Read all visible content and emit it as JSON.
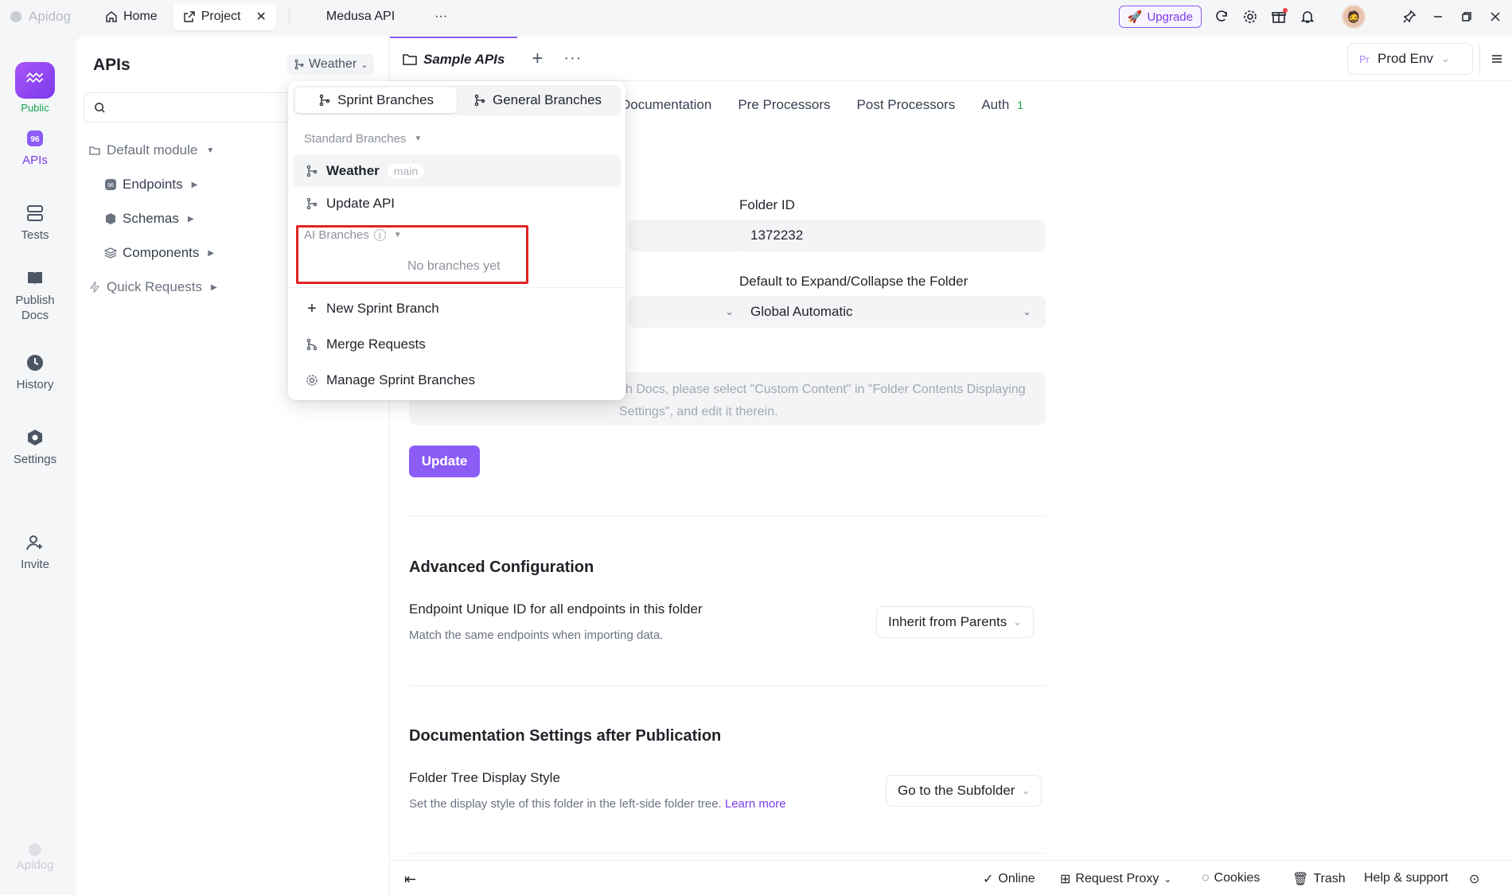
{
  "topbar": {
    "logo": "Apidog",
    "tabs": [
      {
        "label": "Home"
      },
      {
        "label": "Project"
      },
      {
        "label": "Medusa API"
      }
    ],
    "more": "···",
    "upgrade": "Upgrade"
  },
  "rail": {
    "public": "Public",
    "items": [
      {
        "label": "APIs"
      },
      {
        "label": "Tests"
      },
      {
        "label": "Publish Docs"
      },
      {
        "label": "History"
      },
      {
        "label": "Settings"
      },
      {
        "label": "Invite"
      }
    ],
    "footer_logo": "Apidog"
  },
  "sidebar": {
    "title": "APIs",
    "branch": "Weather",
    "tree": [
      {
        "label": "Default module"
      },
      {
        "label": "Endpoints"
      },
      {
        "label": "Schemas"
      },
      {
        "label": "Components"
      },
      {
        "label": "Quick Requests"
      }
    ]
  },
  "main": {
    "tab_label": "Sample APIs",
    "env": {
      "prefix": "Pr",
      "label": "Prod Env"
    },
    "subtabs": [
      "Documentation",
      "Pre Processors",
      "Post Processors",
      "Auth"
    ],
    "auth_badge": "1",
    "folder_id_label": "Folder ID",
    "folder_id_value": "1372232",
    "expand_label": "Default to Expand/Collapse the Folder",
    "expand_value": "Global Automatic",
    "textarea_text": "sh Docs, please select \"Custom Content\" in \"Folder Contents Displaying Settings\", and edit it therein.",
    "update_button": "Update",
    "advanced_title": "Advanced Configuration",
    "unique_id_label": "Endpoint Unique ID for all endpoints in this folder",
    "unique_id_desc": "Match the same endpoints when importing data.",
    "unique_id_value": "Inherit from Parents",
    "doc_settings_title": "Documentation Settings after Publication",
    "tree_style_label": "Folder Tree Display Style",
    "tree_style_desc": "Set the display style of this folder in the left-side folder tree.",
    "learn_more": "Learn more",
    "tree_style_value": "Go to the Subfolder"
  },
  "bottombar": {
    "online": "Online",
    "proxy": "Request Proxy",
    "cookies": "Cookies",
    "trash": "Trash",
    "help": "Help & support"
  },
  "dropdown": {
    "seg_sprint": "Sprint Branches",
    "seg_general": "General Branches",
    "standard_heading": "Standard Branches",
    "branches": [
      {
        "label": "Weather",
        "tag": "main"
      },
      {
        "label": "Update API"
      }
    ],
    "ai_heading": "AI Branches",
    "ai_empty": "No branches yet",
    "actions": [
      {
        "label": "New Sprint Branch"
      },
      {
        "label": "Merge Requests"
      },
      {
        "label": "Manage Sprint Branches"
      }
    ]
  },
  "colors": {
    "accent": "#8b5cf6",
    "highlight": "#e02424",
    "public": "#16a34a"
  }
}
